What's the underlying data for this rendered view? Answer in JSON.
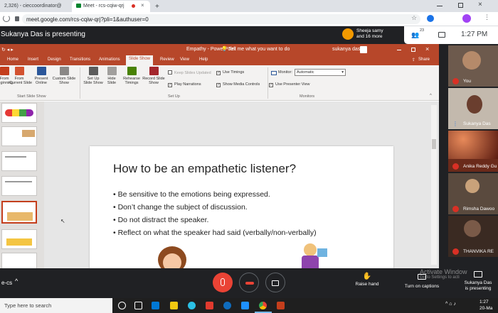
{
  "browser": {
    "tabs": [
      {
        "label": "2,326) - cieccoordinator@"
      },
      {
        "label": "Meet - rcs-cqiw-qrj"
      }
    ],
    "new_tab": "+",
    "url": "meet.google.com/rcs-cqiw-qrj?pli=1&authuser=0"
  },
  "meet": {
    "presenting_banner": "Sukanya Das is presenting",
    "participants_summary": {
      "line1": "Sheeja samy",
      "line2": "and 16 more"
    },
    "participant_count": "23",
    "time": "1:27 PM",
    "meeting_code": "e-cs",
    "participants": [
      {
        "name": "You"
      },
      {
        "name": "Sukanya Das"
      },
      {
        "name": "Anika Reddy Gu"
      },
      {
        "name": "Rimsha Dawoo"
      },
      {
        "name": "THANVIKA RE"
      }
    ],
    "controls": {
      "raise_hand": "Raise hand",
      "captions": "Turn on captions",
      "presenting": "Sukanya Das\nis presenting"
    },
    "watermark": {
      "line1": "Activate Window",
      "line2": "Go to Settings to acti"
    }
  },
  "powerpoint": {
    "title": "Empathy - PowerPoint",
    "search": "Tell me what you want to do",
    "user": "sukanya das",
    "share": "Share",
    "tabs": [
      "Home",
      "Insert",
      "Design",
      "Transitions",
      "Animations",
      "Slide Show",
      "Review",
      "View",
      "Help"
    ],
    "active_tab": "Slide Show",
    "ribbon": {
      "from_start": "From\nBeginning",
      "from_current": "From\nCurrent Slide",
      "present_online": "Present\nOnline",
      "custom_show": "Custom Slide\nShow",
      "group_start": "Start Slide Show",
      "setup_show": "Set Up\nSlide Show",
      "hide_slide": "Hide\nSlide",
      "rehearse": "Rehearse\nTimings",
      "record": "Record Slide\nShow",
      "keep_updated": "Keep Slides Updated",
      "play_narrations": "Play Narrations",
      "use_timings": "Use Timings",
      "show_media": "Show Media Controls",
      "group_setup": "Set Up",
      "monitor_label": "Monitor:",
      "monitor_value": "Automatic",
      "presenter_view": "Use Presenter View",
      "group_monitors": "Monitors"
    },
    "slide": {
      "title": "How to be an empathetic listener?",
      "bullets": [
        "Be sensitive to the emotions being expressed.",
        "Don’t change the subject of discussion.",
        "Do not distract the speaker.",
        "Reflect on what the speaker had said (verbally/non-verbally)"
      ]
    }
  },
  "taskbar": {
    "search_placeholder": "Type here to search",
    "time": "1:27",
    "date": "20-Ma"
  }
}
